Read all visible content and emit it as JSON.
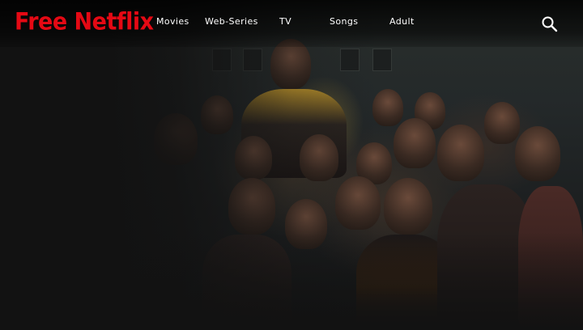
{
  "brand": {
    "logo_text": "Free Netflix",
    "accent_color": "#e50914"
  },
  "nav": {
    "items": [
      {
        "label": "Movies"
      },
      {
        "label": "Web-Series"
      },
      {
        "label": "TV"
      },
      {
        "label": "Songs"
      },
      {
        "label": "Adult"
      }
    ]
  },
  "header": {
    "search_icon": "search-icon"
  },
  "hero": {
    "image": "banner-artwork"
  }
}
